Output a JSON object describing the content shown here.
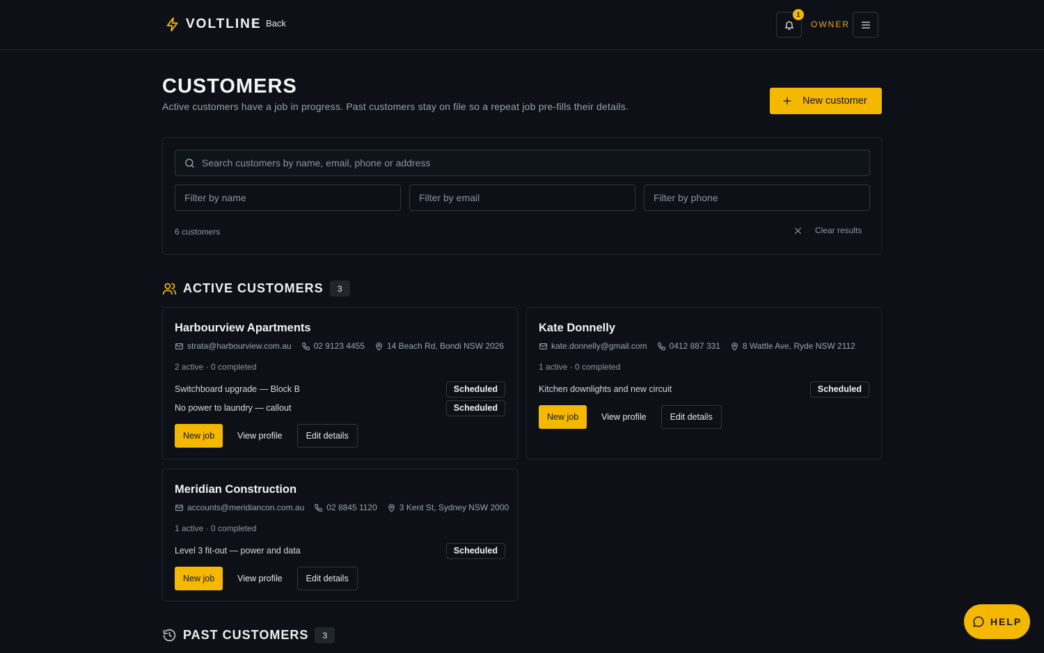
{
  "brand": {
    "name": "VOLTLINE"
  },
  "nav": {
    "back_label": "Back",
    "notification_count": "1",
    "role_label": "OWNER"
  },
  "header": {
    "title": "CUSTOMERS",
    "subtitle": "Active customers have a job in progress. Past customers stay on file so a repeat job pre-fills their details.",
    "new_customer_label": "New customer"
  },
  "search": {
    "placeholder": "Search customers by name, email, phone or address",
    "filter_name_placeholder": "Filter by name",
    "filter_email_placeholder": "Filter by email",
    "filter_phone_placeholder": "Filter by phone",
    "result_count": "6 customers",
    "clear_label": "Clear results"
  },
  "active_section": {
    "title": "ACTIVE CUSTOMERS",
    "count": "3"
  },
  "past_section": {
    "title": "PAST CUSTOMERS",
    "count": "3"
  },
  "customers": [
    {
      "name": "Harbourview Apartments",
      "email": "strata@harbourview.com.au",
      "phone": "02 9123 4455",
      "address": "14 Beach Rd, Bondi NSW 2026",
      "stats": "2 active · 0 completed",
      "jobs": [
        {
          "title": "Switchboard upgrade — Block B",
          "status": "Scheduled"
        },
        {
          "title": "No power to laundry — callout",
          "status": "Scheduled"
        }
      ]
    },
    {
      "name": "Kate Donnelly",
      "email": "kate.donnelly@gmail.com",
      "phone": "0412 887 331",
      "address": "8 Wattle Ave, Ryde NSW 2112",
      "stats": "1 active · 0 completed",
      "jobs": [
        {
          "title": "Kitchen downlights and new circuit",
          "status": "Scheduled"
        }
      ]
    },
    {
      "name": "Meridian Construction",
      "email": "accounts@meridiancon.com.au",
      "phone": "02 8845 1120",
      "address": "3 Kent St, Sydney NSW 2000",
      "stats": "1 active · 0 completed",
      "jobs": [
        {
          "title": "Level 3 fit-out — power and data",
          "status": "Scheduled"
        }
      ]
    }
  ],
  "card_actions": {
    "new_job": "New job",
    "view_profile": "View profile",
    "edit_details": "Edit details"
  },
  "help": {
    "label": "HELP"
  },
  "colors": {
    "accent": "#f5b800",
    "background": "#0d1117",
    "border": "#21262d"
  }
}
